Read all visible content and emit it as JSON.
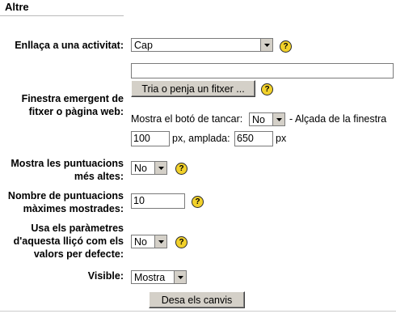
{
  "section": {
    "legend": "Altre"
  },
  "fields": {
    "activity_link": {
      "label": "Enllaça a una activitat:",
      "value": "Cap"
    },
    "popup_file": {
      "label_line1": "Finestra emergent de",
      "label_line2": "fitxer o pàgina web:",
      "url_value": "",
      "choose_button": "Tria o penja un fitxer ...",
      "close_button_text": "Mostra el botó de tancar:",
      "close_button_value": "No",
      "height_text": "- Alçada de la finestra",
      "height_value": "100",
      "px_unit": "px",
      "width_text": "px, amplada:",
      "width_value": "650",
      "width_unit": "px"
    },
    "show_high_scores": {
      "label_line1": "Mostra les puntuacions",
      "label_line2": "més altes:",
      "value": "No"
    },
    "max_high_scores": {
      "label_line1": "Nombre de puntuacions",
      "label_line2": "màximes mostrades:",
      "value": "10"
    },
    "use_defaults": {
      "label_line1": "Usa els paràmetres",
      "label_line2": "d'aquesta lliçó com els",
      "label_line3": "valors per defecte:",
      "value": "No"
    },
    "visible": {
      "label": "Visible:",
      "value": "Mostra"
    }
  },
  "help_glyph": "?",
  "icons": {
    "help": "help-icon",
    "dropdown": "chevron-down-icon"
  },
  "submit": {
    "label": "Desa els canvis"
  },
  "colors": {
    "help_yellow": "#f2d12a",
    "button_face": "#d4d0c8"
  }
}
